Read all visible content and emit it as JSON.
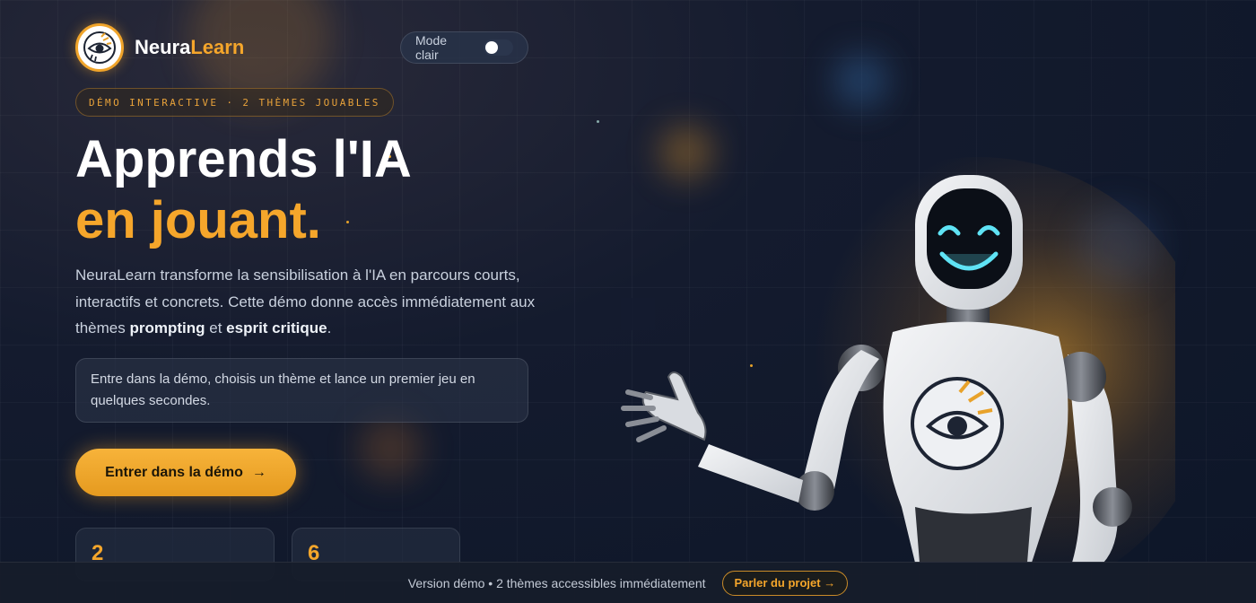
{
  "brand": {
    "name_part1": "Neura",
    "name_part2": "Learn",
    "logo_icon": "eye-circuit-logo"
  },
  "mode_toggle": {
    "label": "Mode clair",
    "state": "off"
  },
  "badge": {
    "text": "DÉMO INTERACTIVE · 2 THÈMES JOUABLES"
  },
  "hero": {
    "title_line1": "Apprends l'IA",
    "title_line2": "en jouant.",
    "intro_part1": "NeuraLearn transforme la sensibilisation à l'IA en parcours courts, interactifs et concrets. Cette démo donne accès immédiatement aux thèmes ",
    "intro_bold1": "prompting",
    "intro_part2": " et ",
    "intro_bold2": "esprit critique",
    "intro_part3": ".",
    "hint": "Entre dans la démo, choisis un thème et lance un premier jeu en quelques secondes.",
    "cta_label": "Entrer dans la démo",
    "cta_arrow": "→"
  },
  "stats": [
    {
      "value": "2"
    },
    {
      "value": "6"
    }
  ],
  "footer": {
    "text": "Version démo • 2 thèmes accessibles immédiatement",
    "button_label": "Parler du projet →"
  },
  "colors": {
    "accent": "#f5a62b",
    "background": "#141b2e",
    "robot_face": "#5fe3f5"
  }
}
